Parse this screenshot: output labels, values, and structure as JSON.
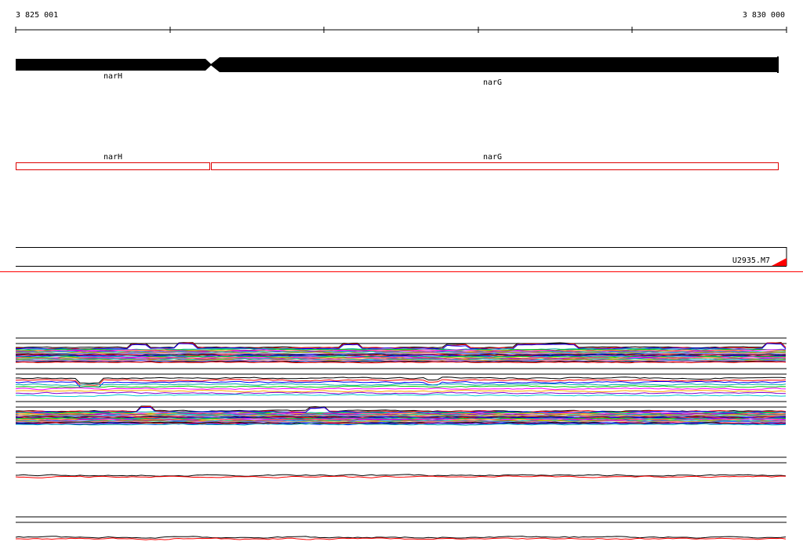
{
  "ruler": {
    "start_label": "3 825 001",
    "end_label": "3 830 000"
  },
  "genes": [
    {
      "name": "narH",
      "strand": "forward"
    },
    {
      "name": "narG",
      "strand": "reverse"
    }
  ],
  "features": [
    {
      "name": "narH"
    },
    {
      "name": "narG"
    }
  ],
  "sample": {
    "label": "U2935.M7"
  },
  "colors": {
    "gene": "#000000",
    "feature_outline": "#dd0000",
    "separator": "#ff0000",
    "coverage_palette": [
      "#000000",
      "#ff0000",
      "#0000ff",
      "#00aaaa",
      "#00cc00",
      "#ff00ff",
      "#ffaa00",
      "#8800cc",
      "#00cccc",
      "#aaaa00",
      "#ff6699",
      "#3366ff"
    ]
  }
}
